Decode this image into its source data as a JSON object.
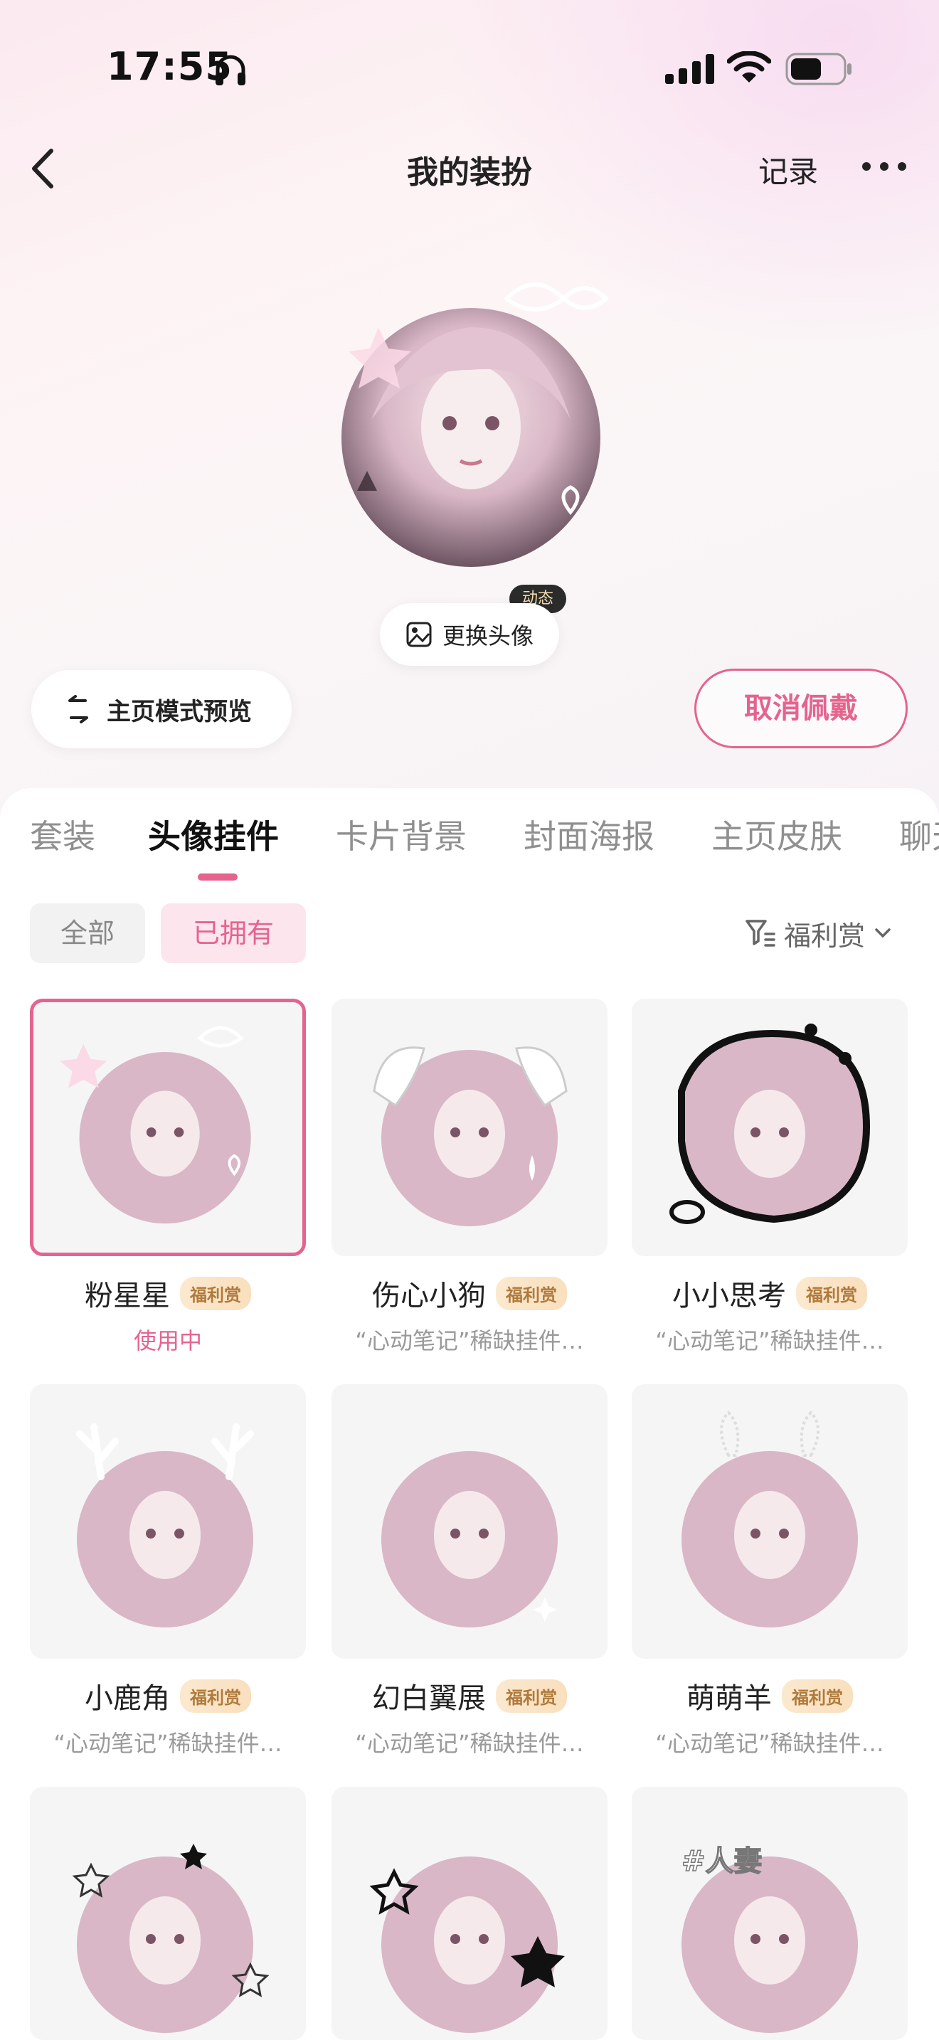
{
  "status_bar": {
    "time": "17:55"
  },
  "nav": {
    "title": "我的装扮",
    "record": "记录"
  },
  "avatar": {
    "dynamic_badge": "动态",
    "change_label": "更换头像"
  },
  "actions": {
    "preview_label": "主页模式预览",
    "unwear_label": "取消佩戴"
  },
  "tabs": [
    "套装",
    "头像挂件",
    "卡片背景",
    "封面海报",
    "主页皮肤",
    "聊天"
  ],
  "active_tab": "头像挂件",
  "filters": {
    "all": "全部",
    "owned": "已拥有",
    "sort": "福利赏"
  },
  "items": [
    {
      "name": "粉星星",
      "badge": "福利赏",
      "sub": "使用中",
      "in_use": true,
      "decor": "stars-bow"
    },
    {
      "name": "伤心小狗",
      "badge": "福利赏",
      "sub": "“心动笔记”稀缺挂件…",
      "in_use": false,
      "decor": "dog-ears"
    },
    {
      "name": "小小思考",
      "badge": "福利赏",
      "sub": "“心动笔记”稀缺挂件…",
      "in_use": false,
      "decor": "thought"
    },
    {
      "name": "小鹿角",
      "badge": "福利赏",
      "sub": "“心动笔记”稀缺挂件…",
      "in_use": false,
      "decor": "antlers"
    },
    {
      "name": "幻白翼展",
      "badge": "福利赏",
      "sub": "“心动笔记”稀缺挂件…",
      "in_use": false,
      "decor": "sparkle"
    },
    {
      "name": "萌萌羊",
      "badge": "福利赏",
      "sub": "“心动笔记”稀缺挂件…",
      "in_use": false,
      "decor": "sheep"
    },
    {
      "name": "",
      "badge": "",
      "sub": "",
      "in_use": false,
      "decor": "outline-stars"
    },
    {
      "name": "",
      "badge": "",
      "sub": "",
      "in_use": false,
      "decor": "black-stars"
    },
    {
      "name": "",
      "badge": "",
      "sub": "",
      "in_use": false,
      "decor": "tag",
      "tag_text": "#人妻"
    }
  ],
  "colors": {
    "accent": "#e5648d",
    "badge_text": "#b07a3c"
  }
}
